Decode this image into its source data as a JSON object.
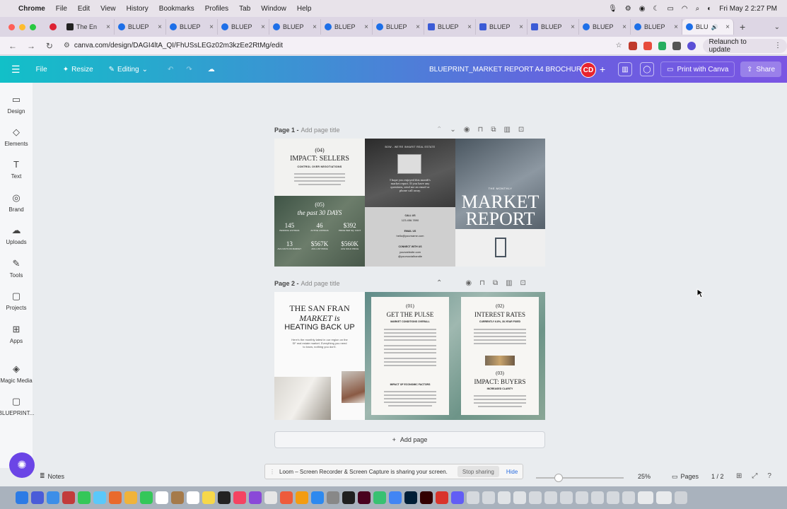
{
  "menubar": {
    "app": "Chrome",
    "items": [
      "File",
      "Edit",
      "View",
      "History",
      "Bookmarks",
      "Profiles",
      "Tab",
      "Window",
      "Help"
    ],
    "clock": "Fri May 2  2:27 PM"
  },
  "tabs": [
    {
      "title": "The En"
    },
    {
      "title": "BLUEP"
    },
    {
      "title": "BLUEP"
    },
    {
      "title": "BLUEP"
    },
    {
      "title": "BLUEP"
    },
    {
      "title": "BLUEP"
    },
    {
      "title": "BLUEP"
    },
    {
      "title": "BLUEP"
    },
    {
      "title": "BLUEP"
    },
    {
      "title": "BLUEP"
    },
    {
      "title": "BLUEP"
    },
    {
      "title": "BLUEP"
    },
    {
      "title": "BLU"
    }
  ],
  "address": {
    "url": "canva.com/design/DAGI4ltA_QI/FhUSsLEGz02m3kzEe2RtMg/edit",
    "relaunch": "Relaunch to update"
  },
  "header": {
    "file": "File",
    "resize": "Resize",
    "editing": "Editing",
    "title": "BLUEPRINT_MARKET REPORT A4 BROCHURE",
    "avatar": "CD",
    "print": "Print with Canva",
    "share": "Share"
  },
  "sidebar": [
    {
      "label": "Design",
      "icon": "design-icon",
      "glyph": "▭"
    },
    {
      "label": "Elements",
      "icon": "elements-icon",
      "glyph": "◇"
    },
    {
      "label": "Text",
      "icon": "text-icon",
      "glyph": "T"
    },
    {
      "label": "Brand",
      "icon": "brand-icon",
      "glyph": "◎"
    },
    {
      "label": "Uploads",
      "icon": "uploads-icon",
      "glyph": "☁"
    },
    {
      "label": "Tools",
      "icon": "tools-icon",
      "glyph": "✎"
    },
    {
      "label": "Projects",
      "icon": "projects-icon",
      "glyph": "▢"
    },
    {
      "label": "Apps",
      "icon": "apps-icon",
      "glyph": "⊞"
    },
    {
      "label": "Magic Media",
      "icon": "magic-media-icon",
      "glyph": "◈"
    },
    {
      "label": "BLUEPRINT...",
      "icon": "folder-icon",
      "glyph": "▢"
    }
  ],
  "page1": {
    "label": "Page 1 -",
    "placeholder": "Add page title",
    "p04": "(04)",
    "impact_sellers": "IMPACT: SELLERS",
    "control": "CONTROL OVER NEGOTIATIONS",
    "p05": "(05)",
    "past": "the past 30 DAYS",
    "stats": [
      {
        "v": "145",
        "l": "PENDING LISTINGS"
      },
      {
        "v": "46",
        "l": "ACTIVE LISTINGS"
      },
      {
        "v": "$392",
        "l": "PRICE PER SQ. FOOT"
      },
      {
        "v": "13",
        "l": "AVG DAYS ON MARKET"
      },
      {
        "v": "$567K",
        "l": "AVG LIST PRICE"
      },
      {
        "v": "$560K",
        "l": "AVG SOLD PRICE"
      }
    ],
    "agency": "BOW - WE'RE INHARIT REAL ESTATE",
    "hope": "I hope you enjoyed this month's market report. If you have any questions, send me an email or phone call away.",
    "call": "CALL US",
    "phone": "123.456.7890",
    "email_label": "EMAIL US",
    "email": "hello@yourname.com",
    "connect": "CONNECT WITH US",
    "web": "yourwebsite.com",
    "social": "@yoursocialhandle",
    "monthly": "THE MONTHLY",
    "market": "MARKET",
    "report": "REPORT"
  },
  "page2": {
    "label": "Page 2 -",
    "placeholder": "Add page title",
    "sf1": "THE SAN FRAN",
    "sf2": "MARKET is",
    "sf3": "HEATING BACK UP",
    "sf_body": "Here's the monthly latest in our region on the SF real estate market. Everything you need to know, nothing you don't.",
    "p01": "(01)",
    "pulse": "GET THE PULSE",
    "conditions": "MARKET CONDITIONS OVERALL",
    "econ": "IMPACT OF ECONOMIC FACTORS",
    "p02": "(02)",
    "rates": "INTEREST RATES",
    "fixed": "CURRENTLY 6.8%, 30-YEAR FIXED",
    "p03": "(03)",
    "buyers": "IMPACT: BUYERS",
    "clarity": "INCREASED CLARITY"
  },
  "addpage": "Add page",
  "loom": {
    "message": "Loom – Screen Recorder & Screen Capture is sharing your screen.",
    "stop": "Stop sharing",
    "hide": "Hide"
  },
  "bottom": {
    "notes": "Notes",
    "zoom": "25%",
    "zoom_fraction": 0.25,
    "pages": "Pages",
    "page_count": "1 / 2"
  },
  "colors": {
    "header_start": "#12c0c8",
    "header_end": "#7a55e3",
    "avatar": "#e8232e",
    "fab": "#6b45e6"
  }
}
